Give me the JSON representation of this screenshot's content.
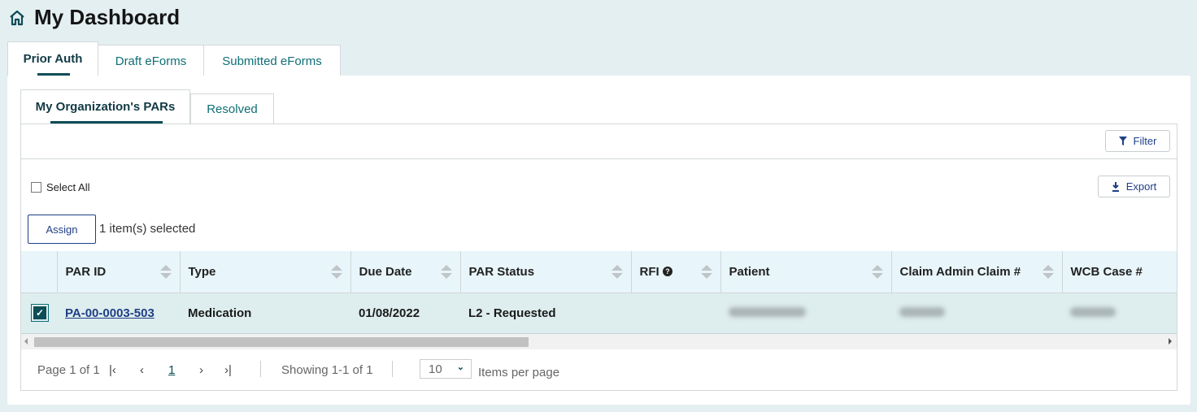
{
  "header": {
    "title": "My Dashboard",
    "icon": "home-icon"
  },
  "main_tabs": [
    {
      "label": "Prior Auth",
      "active": true
    },
    {
      "label": "Draft eForms"
    },
    {
      "label": "Submitted eForms"
    }
  ],
  "sub_tabs": [
    {
      "label": "My Organization's PARs",
      "active": true
    },
    {
      "label": "Resolved"
    }
  ],
  "toolbar": {
    "filter_label": "Filter",
    "export_label": "Export",
    "select_all_label": "Select All",
    "assign_label": "Assign",
    "selected_text": "1 item(s) selected"
  },
  "table": {
    "columns": [
      "PAR ID",
      "Type",
      "Due Date",
      "PAR Status",
      "RFI",
      "Patient",
      "Claim Admin Claim #",
      "WCB Case #"
    ],
    "rows": [
      {
        "selected": true,
        "par_id": "PA-00-0003-503",
        "type": "Medication",
        "due_date": "01/08/2022",
        "status": "L2 - Requested",
        "rfi": ""
      }
    ]
  },
  "pagination": {
    "page_text": "Page 1 of 1",
    "current_page": "1",
    "showing": "Showing 1-1 of 1",
    "page_size": "10",
    "items_per_page_label": "Items per page"
  },
  "colors": {
    "accent": "#0d4d56",
    "link": "#1f3f86",
    "background": "#e4eff1"
  }
}
